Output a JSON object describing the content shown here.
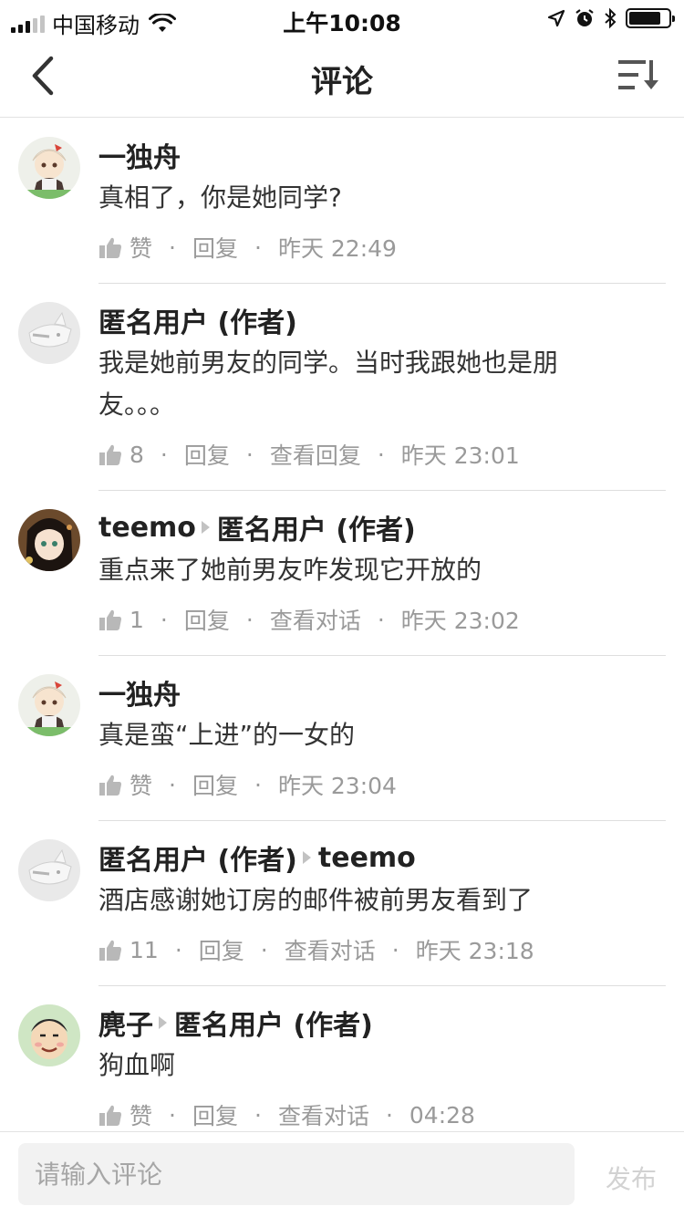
{
  "status_bar": {
    "carrier": "中国移动",
    "time": "上午10:08"
  },
  "nav": {
    "title": "评论",
    "back_icon": "chevron-left-icon",
    "sort_icon": "sort-icon"
  },
  "comments": [
    {
      "avatar": "avatar-anime-cat-girl",
      "author": "一独舟",
      "reply_to": "",
      "text": "真相了，你是她同学?",
      "likes": "赞",
      "reply_label": "回复",
      "view_label": "",
      "time": "昨天 22:49"
    },
    {
      "avatar": "avatar-anonymous",
      "author": "匿名用户 (作者)",
      "reply_to": "",
      "text": "我是她前男友的同学。当时我跟她也是朋友。。。",
      "likes": "8",
      "reply_label": "回复",
      "view_label": "查看回复",
      "time": "昨天 23:01"
    },
    {
      "avatar": "avatar-anime-girl",
      "author": "teemo",
      "reply_to": "匿名用户 (作者)",
      "text": "重点来了她前男友咋发现它开放的",
      "likes": "1",
      "reply_label": "回复",
      "view_label": "查看对话",
      "time": "昨天 23:02"
    },
    {
      "avatar": "avatar-anime-cat-girl",
      "author": "一独舟",
      "reply_to": "",
      "text": "真是蛮“上进”的一女的",
      "likes": "赞",
      "reply_label": "回复",
      "view_label": "",
      "time": "昨天 23:04"
    },
    {
      "avatar": "avatar-anonymous",
      "author": "匿名用户 (作者)",
      "reply_to": "teemo",
      "text": "酒店感谢她订房的邮件被前男友看到了",
      "likes": "11",
      "reply_label": "回复",
      "view_label": "查看对话",
      "time": "昨天 23:18"
    },
    {
      "avatar": "avatar-cartoon-face",
      "author": "麂子",
      "reply_to": "匿名用户 (作者)",
      "text": "狗血啊",
      "likes": "赞",
      "reply_label": "回复",
      "view_label": "查看对话",
      "time": "04:28"
    }
  ],
  "input_bar": {
    "placeholder": "请输入评论",
    "publish_label": "发布"
  },
  "colors": {
    "text_primary": "#222222",
    "text_meta": "#9a9a9a",
    "divider": "#dedede",
    "input_bg": "#f2f2f2",
    "publish_disabled": "#d2d2d2"
  }
}
